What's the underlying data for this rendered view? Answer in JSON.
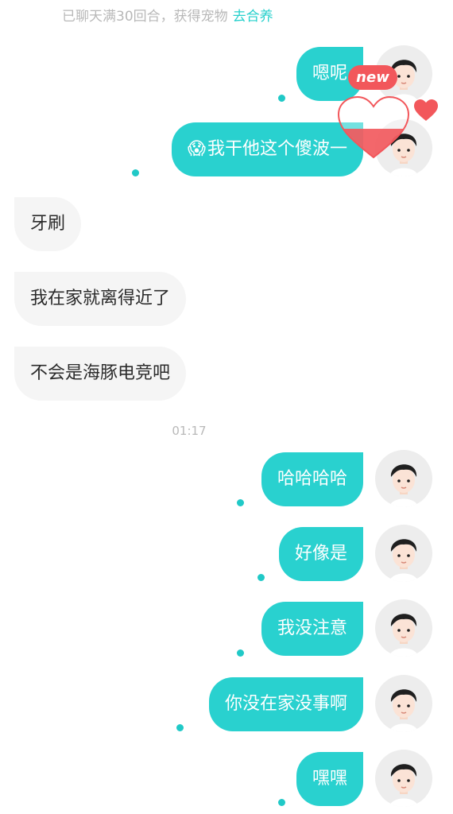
{
  "notice": {
    "text": "已聊天满30回合，获得宠物",
    "action": "去合养"
  },
  "messages": [
    {
      "id": "m1",
      "side": "out",
      "text": "嗯呢"
    },
    {
      "id": "m2",
      "side": "out",
      "emoji": "😱",
      "text": "我干他这个傻波一"
    },
    {
      "id": "m3",
      "side": "in",
      "text": "牙刷"
    },
    {
      "id": "m4",
      "side": "in",
      "text": "我在家就离得近了"
    },
    {
      "id": "m5",
      "side": "in",
      "text": "不会是海豚电竞吧"
    },
    {
      "id": "m6",
      "side": "out",
      "text": "哈哈哈哈"
    },
    {
      "id": "m7",
      "side": "out",
      "text": "好像是"
    },
    {
      "id": "m8",
      "side": "out",
      "text": "我没注意"
    },
    {
      "id": "m9",
      "side": "out",
      "text": "你没在家没事啊"
    },
    {
      "id": "m10",
      "side": "out",
      "text": "嘿嘿"
    }
  ],
  "timestamp": "01:17",
  "badge": {
    "label": "new"
  },
  "icons": {
    "avatar": "cartoon-boy-avatar-icon",
    "heart": "heart-icon"
  },
  "colors": {
    "accent": "#29d1cf",
    "bubble_in": "#f5f5f5",
    "badge": "#f2575b",
    "heart": "#f2575b"
  }
}
